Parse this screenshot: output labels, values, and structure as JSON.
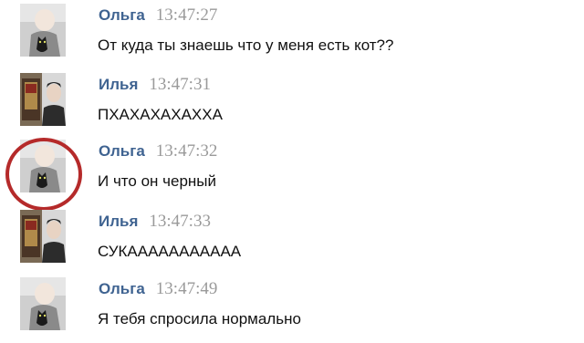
{
  "messages": [
    {
      "author": "Ольга",
      "time": "13:47:27",
      "text": "От куда ты знаешь что у меня есть кот??",
      "avatar": "olga-cat-photo",
      "highlighted": false
    },
    {
      "author": "Илья",
      "time": "13:47:31",
      "text": "ПХАХАХАХАХХА",
      "avatar": "ilya-photo",
      "highlighted": false
    },
    {
      "author": "Ольга",
      "time": "13:47:32",
      "text": "И что он черный",
      "avatar": "olga-cat-photo",
      "highlighted": true
    },
    {
      "author": "Илья",
      "time": "13:47:33",
      "text": "СУКААААААААААА",
      "avatar": "ilya-photo",
      "highlighted": false
    },
    {
      "author": "Ольга",
      "time": "13:47:49",
      "text": "Я тебя спросила нормально",
      "avatar": "olga-cat-photo",
      "highlighted": false
    }
  ],
  "colors": {
    "author": "#3f6391",
    "time": "#9a9a9a",
    "text": "#111111",
    "highlight_circle": "#b52a2a"
  }
}
